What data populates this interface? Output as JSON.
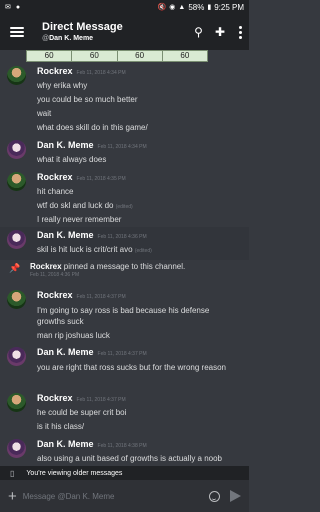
{
  "statusbar": {
    "battery": "58%",
    "time": "9:25 PM"
  },
  "header": {
    "title": "Direct Message",
    "subtitle_prefix": "@",
    "subtitle_user": "Dan K. Meme"
  },
  "embed_table": [
    "60",
    "60",
    "60",
    "60"
  ],
  "messages": [
    {
      "author": "Rockrex",
      "time": "Feb 11, 2018 4:34 PM",
      "lines": [
        "why erika why",
        "you could be so much better",
        "wait",
        "what does skill do in this game/"
      ]
    },
    {
      "author": "Dan K. Meme",
      "time": "Feb 11, 2018 4:34 PM",
      "lines": [
        "what it always does"
      ]
    },
    {
      "author": "Rockrex",
      "time": "Feb 11, 2018 4:35 PM",
      "lines": [
        "hit chance",
        "wtf do skl and luck do",
        "I really never remember"
      ],
      "edited": "(edited)"
    },
    {
      "author": "Dan K. Meme",
      "time": "Feb 11, 2018 4:36 PM",
      "lines": [
        "skil is hit luck is crit/crit avo"
      ],
      "edited": "(edited)"
    },
    {
      "author": "Rockrex",
      "time": "Feb 11, 2018 4:37 PM",
      "lines": [
        "I'm going to say ross is bad because his defense growths suck",
        "man rip joshuas luck"
      ]
    },
    {
      "author": "Dan K. Meme",
      "time": "Feb 11, 2018 4:37 PM",
      "lines": [
        "you are right that ross sucks but for the wrong reason"
      ]
    },
    {
      "author": "Rockrex",
      "time": "Feb 11, 2018 4:37 PM",
      "lines": [
        "he could be super crit boi",
        "is it his class/"
      ]
    },
    {
      "author": "Dan K. Meme",
      "time": "Feb 11, 2018 4:38 PM",
      "lines": [
        "also using a unit based of growths is actually a noob"
      ]
    }
  ],
  "pin": {
    "user": "Rockrex",
    "text": " pinned a message to this channel.",
    "time": "Feb 11, 2018 4:36 PM"
  },
  "older_bar": {
    "text": "You're viewing older messages"
  },
  "composer": {
    "placeholder": "Message @Dan K. Meme"
  }
}
